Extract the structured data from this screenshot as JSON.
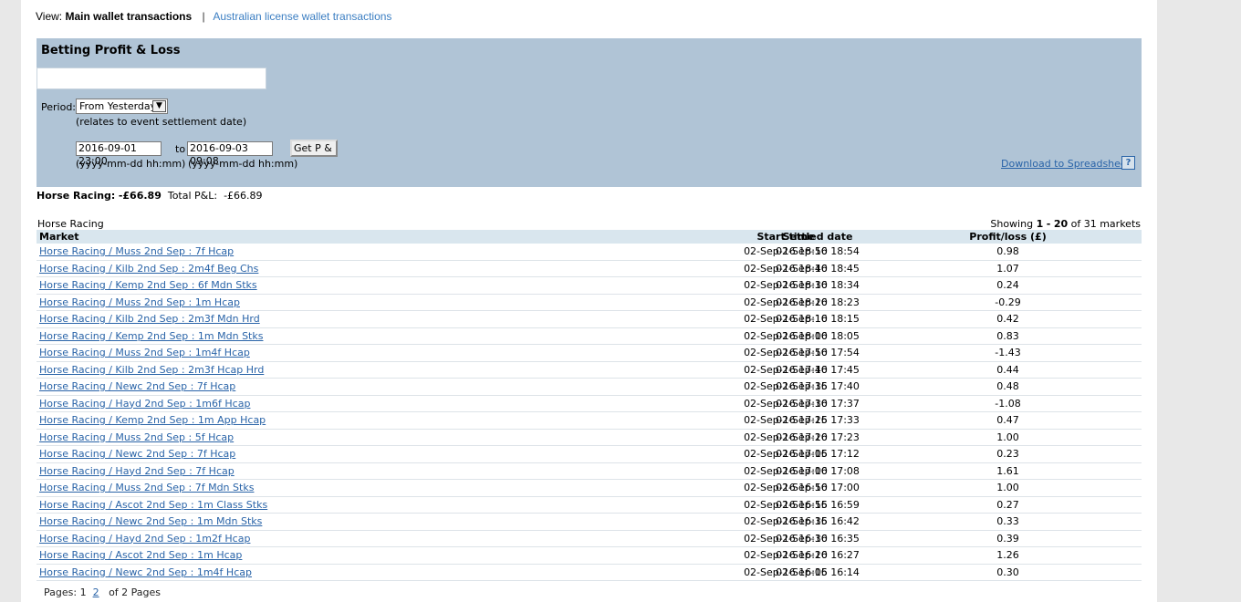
{
  "view": {
    "prefix": "View:",
    "current": "Main wallet transactions",
    "separator": "|",
    "alternate": "Australian license wallet transactions"
  },
  "panel": {
    "title": "Betting Profit & Loss",
    "period_label": "Period:",
    "period_value": "From Yesterday",
    "period_note": "(relates to event settlement date)",
    "from_value": "2016-09-01 23:00",
    "to_label": "to",
    "to_value": "2016-09-03 09:08",
    "get_button": "Get P & L",
    "format_from": "(yyyy-mm-dd hh:mm)",
    "format_to": "(yyyy-mm-dd hh:mm)",
    "download_label": "Download to Spreadsheet",
    "help_label": "?"
  },
  "summary": {
    "sport_label": "Horse Racing:",
    "sport_value": "-£66.89",
    "total_label": "Total P&L:",
    "total_value": "-£66.89"
  },
  "table_section": {
    "sport": "Horse Racing",
    "showing_prefix": "Showing",
    "showing_range_start": "1",
    "showing_dash": "-",
    "showing_range_end": "20",
    "showing_suffix": "of 31 markets"
  },
  "columns": [
    "Market",
    "Start time",
    "Settled date",
    "Profit/loss (£)"
  ],
  "rows": [
    {
      "market": "Horse Racing / Muss 2nd Sep : 7f Hcap",
      "start": "02-Sep-16 18:50",
      "settled": "02-Sep-16 18:54",
      "pl": "0.98"
    },
    {
      "market": "Horse Racing / Kilb 2nd Sep : 2m4f Beg Chs",
      "start": "02-Sep-16 18:40",
      "settled": "02-Sep-16 18:45",
      "pl": "1.07"
    },
    {
      "market": "Horse Racing / Kemp 2nd Sep : 6f Mdn Stks",
      "start": "02-Sep-16 18:30",
      "settled": "02-Sep-16 18:34",
      "pl": "0.24"
    },
    {
      "market": "Horse Racing / Muss 2nd Sep : 1m Hcap",
      "start": "02-Sep-16 18:20",
      "settled": "02-Sep-16 18:23",
      "pl": "-0.29"
    },
    {
      "market": "Horse Racing / Kilb 2nd Sep : 2m3f Mdn Hrd",
      "start": "02-Sep-16 18:10",
      "settled": "02-Sep-16 18:15",
      "pl": "0.42"
    },
    {
      "market": "Horse Racing / Kemp 2nd Sep : 1m Mdn Stks",
      "start": "02-Sep-16 18:00",
      "settled": "02-Sep-16 18:05",
      "pl": "0.83"
    },
    {
      "market": "Horse Racing / Muss 2nd Sep : 1m4f Hcap",
      "start": "02-Sep-16 17:50",
      "settled": "02-Sep-16 17:54",
      "pl": "-1.43"
    },
    {
      "market": "Horse Racing / Kilb 2nd Sep : 2m3f Hcap Hrd",
      "start": "02-Sep-16 17:40",
      "settled": "02-Sep-16 17:45",
      "pl": "0.44"
    },
    {
      "market": "Horse Racing / Newc 2nd Sep : 7f Hcap",
      "start": "02-Sep-16 17:35",
      "settled": "02-Sep-16 17:40",
      "pl": "0.48"
    },
    {
      "market": "Horse Racing / Hayd 2nd Sep : 1m6f Hcap",
      "start": "02-Sep-16 17:30",
      "settled": "02-Sep-16 17:37",
      "pl": "-1.08"
    },
    {
      "market": "Horse Racing / Kemp 2nd Sep : 1m App Hcap",
      "start": "02-Sep-16 17:25",
      "settled": "02-Sep-16 17:33",
      "pl": "0.47"
    },
    {
      "market": "Horse Racing / Muss 2nd Sep : 5f Hcap",
      "start": "02-Sep-16 17:20",
      "settled": "02-Sep-16 17:23",
      "pl": "1.00"
    },
    {
      "market": "Horse Racing / Newc 2nd Sep : 7f Hcap",
      "start": "02-Sep-16 17:05",
      "settled": "02-Sep-16 17:12",
      "pl": "0.23"
    },
    {
      "market": "Horse Racing / Hayd 2nd Sep : 7f Hcap",
      "start": "02-Sep-16 17:00",
      "settled": "02-Sep-16 17:08",
      "pl": "1.61"
    },
    {
      "market": "Horse Racing / Muss 2nd Sep : 7f Mdn Stks",
      "start": "02-Sep-16 16:50",
      "settled": "02-Sep-16 17:00",
      "pl": "1.00"
    },
    {
      "market": "Horse Racing / Ascot 2nd Sep : 1m Class Stks",
      "start": "02-Sep-16 16:55",
      "settled": "02-Sep-16 16:59",
      "pl": "0.27"
    },
    {
      "market": "Horse Racing / Newc 2nd Sep : 1m Mdn Stks",
      "start": "02-Sep-16 16:35",
      "settled": "02-Sep-16 16:42",
      "pl": "0.33"
    },
    {
      "market": "Horse Racing / Hayd 2nd Sep : 1m2f Hcap",
      "start": "02-Sep-16 16:30",
      "settled": "02-Sep-16 16:35",
      "pl": "0.39"
    },
    {
      "market": "Horse Racing / Ascot 2nd Sep : 1m Hcap",
      "start": "02-Sep-16 16:20",
      "settled": "02-Sep-16 16:27",
      "pl": "1.26"
    },
    {
      "market": "Horse Racing / Newc 2nd Sep : 1m4f Hcap",
      "start": "02-Sep-16 16:05",
      "settled": "02-Sep-16 16:14",
      "pl": "0.30"
    }
  ],
  "pager": {
    "label": "Pages:",
    "current": "1",
    "next": "2",
    "suffix": "of 2 Pages"
  },
  "colors": {
    "panel_bg": "#b0c4d6",
    "header_bg": "#d9e6ee",
    "link": "#2a64a8"
  }
}
